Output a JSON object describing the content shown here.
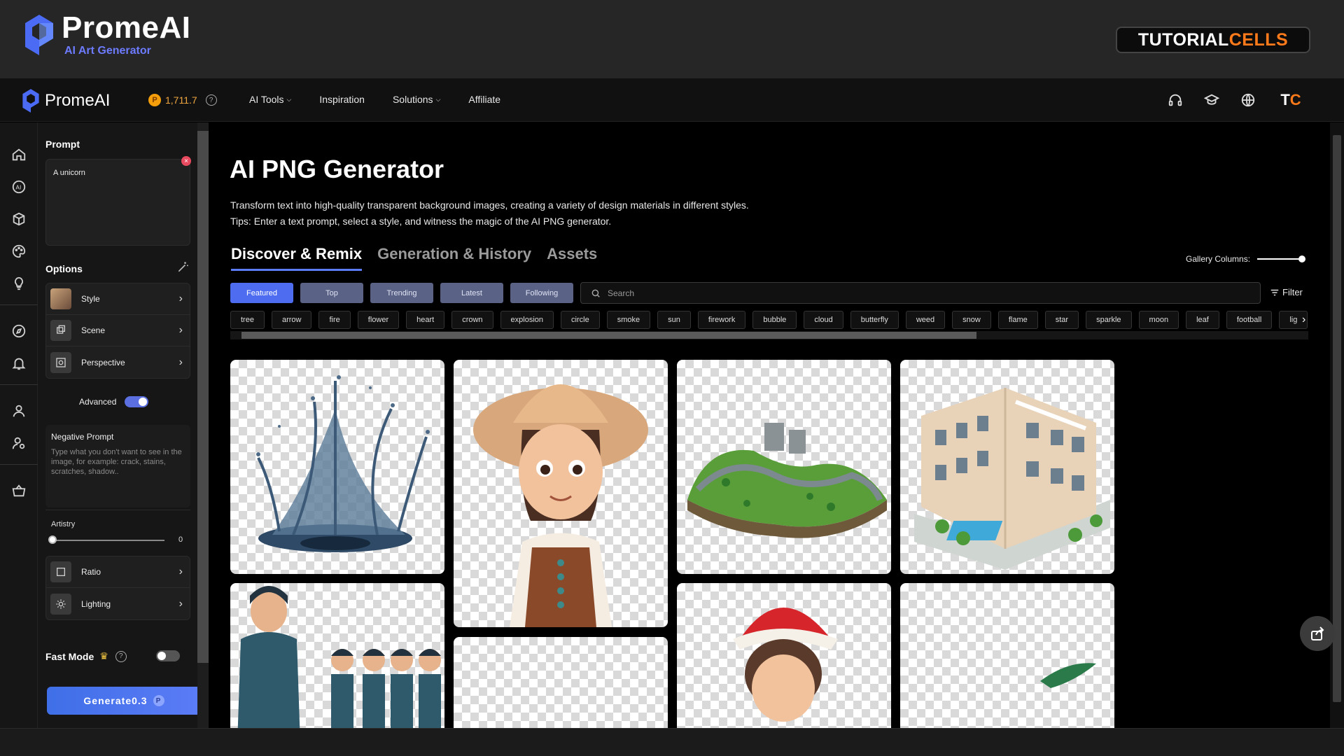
{
  "banner": {
    "brand": "PromeAI",
    "tagline": "AI Art Generator",
    "badge_left": "TUTORIAL",
    "badge_right": "CELLS"
  },
  "navbar": {
    "brand": "PromeAI",
    "credits": "1,711.7",
    "links": [
      "AI Tools",
      "Inspiration",
      "Solutions",
      "Affiliate"
    ],
    "avatar_t": "T",
    "avatar_c": "C"
  },
  "panel": {
    "prompt_label": "Prompt",
    "prompt_value": "A unicorn",
    "options_label": "Options",
    "options": [
      "Style",
      "Scene",
      "Perspective"
    ],
    "advanced_label": "Advanced",
    "advanced_on": true,
    "negative_title": "Negative Prompt",
    "negative_placeholder": "Type what you don't want to see in the image, for example: crack, stains, scratches, shadow..",
    "artistry_label": "Artistry",
    "artistry_value": "0",
    "extra_options": [
      "Ratio",
      "Lighting"
    ],
    "fast_mode_label": "Fast Mode",
    "fast_mode_on": false,
    "generate_label": "Generate",
    "generate_cost": "0.3"
  },
  "main": {
    "title": "AI PNG Generator",
    "desc_line1": "Transform text into high-quality transparent background images, creating a variety of design materials in different styles.",
    "desc_line2": "Tips: Enter a text prompt, select a style, and witness the magic of the AI PNG generator.",
    "tabs": [
      "Discover & Remix",
      "Generation & History",
      "Assets"
    ],
    "active_tab": "Discover & Remix",
    "gallery_columns_label": "Gallery Columns:",
    "filter_buttons": [
      "Featured",
      "Top",
      "Trending",
      "Latest",
      "Following"
    ],
    "active_filter": "Featured",
    "search_placeholder": "Search",
    "filter_link": "Filter",
    "tags": [
      "tree",
      "arrow",
      "fire",
      "flower",
      "heart",
      "crown",
      "explosion",
      "circle",
      "smoke",
      "sun",
      "firework",
      "bubble",
      "cloud",
      "butterfly",
      "weed",
      "snow",
      "flame",
      "star",
      "sparkle",
      "moon",
      "leaf",
      "football",
      "lig"
    ]
  },
  "colors": {
    "accent": "#4d6cf0",
    "filter_inactive": "#5a6285",
    "brand_orange": "#ff7a1a",
    "credits_gold": "#f0a640"
  }
}
